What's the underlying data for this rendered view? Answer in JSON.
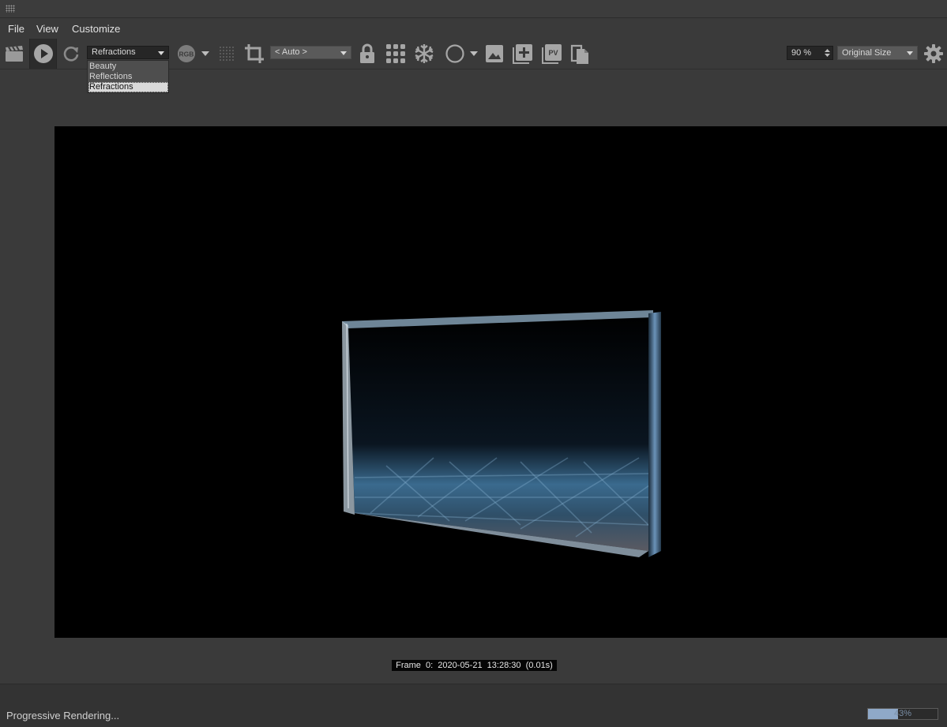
{
  "window": {
    "grip_icon": "grip-dots-icon"
  },
  "menu": {
    "file": "File",
    "view": "View",
    "customize": "Customize"
  },
  "toolbar": {
    "channel_select": "Refractions",
    "channel_options": [
      "Beauty",
      "Reflections",
      "Refractions"
    ],
    "rgb_label": "RGB",
    "region_select": "< Auto >",
    "pv_label": "PV",
    "zoom_value": "90 %",
    "size_select": "Original Size",
    "icons": [
      "clapperboard-icon",
      "play-icon",
      "refresh-icon",
      "rgb-icon",
      "dither-grid-icon",
      "crop-icon",
      "lock-icon",
      "grid-icon",
      "snowflake-icon",
      "circle-icon",
      "image-icon",
      "add-image-icon",
      "pv-icon",
      "copy-icon",
      "gear-icon"
    ]
  },
  "render": {
    "frame_info": "Frame  0:  2020-05-21  13:28:30  (0.01s)"
  },
  "status": {
    "text": "Progressive Rendering...",
    "progress_label": "43%",
    "progress_value": 0.43
  },
  "colors": {
    "accent": "#8fa9c8",
    "background": "#3a3a3a",
    "viewport": "#000000"
  }
}
